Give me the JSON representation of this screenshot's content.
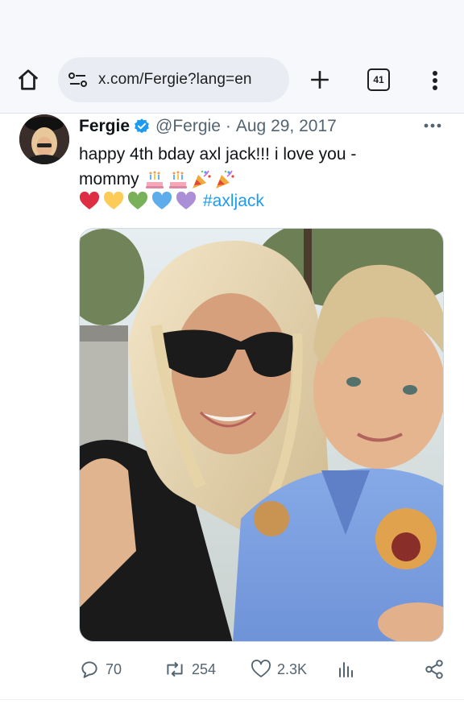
{
  "browser": {
    "url": "x.com/Fergie?lang=en",
    "tab_count": "41",
    "icons": [
      "home-icon",
      "site-settings-icon",
      "new-tab-icon",
      "tab-switcher-icon",
      "more-vert-icon"
    ]
  },
  "tweet": {
    "author_name": "Fergie",
    "verified": true,
    "handle": "@Fergie",
    "separator": "·",
    "date": "Aug 29, 2017",
    "text_line1": "happy 4th bday axl jack!!! i love you -",
    "text_line2": "mommy",
    "line2_emojis": [
      "birthday-cake",
      "birthday-cake",
      "party-popper",
      "party-popper"
    ],
    "hearts": [
      "red-heart",
      "yellow-heart",
      "green-heart",
      "blue-heart",
      "purple-heart"
    ],
    "hashtag": "#axljack",
    "colors": {
      "link": "#1d9bf0",
      "muted": "#536471",
      "text": "#0f1419"
    }
  },
  "actions": {
    "replies": "70",
    "reposts": "254",
    "likes": "2.3K"
  }
}
